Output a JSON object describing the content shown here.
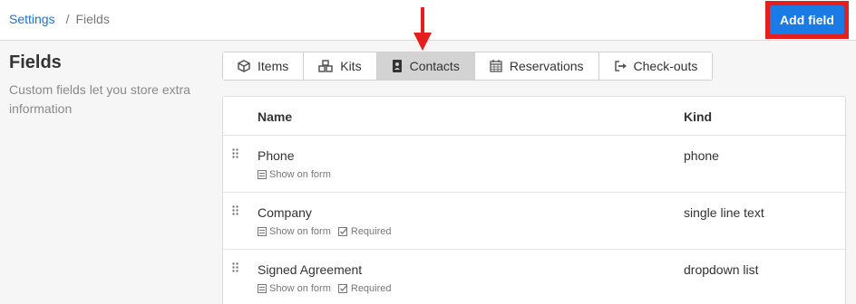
{
  "breadcrumb": {
    "parent": "Settings",
    "separator": "/",
    "current": "Fields"
  },
  "header": {
    "add_button": "Add field"
  },
  "sidebar": {
    "title": "Fields",
    "description": "Custom fields let you store extra information"
  },
  "tabs": [
    {
      "label": "Items",
      "icon": "cube-icon"
    },
    {
      "label": "Kits",
      "icon": "cubes-icon"
    },
    {
      "label": "Contacts",
      "icon": "contact-book-icon",
      "active": true
    },
    {
      "label": "Reservations",
      "icon": "calendar-icon"
    },
    {
      "label": "Check-outs",
      "icon": "sign-out-icon"
    }
  ],
  "table": {
    "columns": {
      "name": "Name",
      "kind": "Kind"
    },
    "rows": [
      {
        "name": "Phone",
        "kind": "phone",
        "badges": [
          "Show on form"
        ]
      },
      {
        "name": "Company",
        "kind": "single line text",
        "badges": [
          "Show on form",
          "Required"
        ]
      },
      {
        "name": "Signed Agreement",
        "kind": "dropdown list",
        "badges": [
          "Show on form",
          "Required"
        ]
      }
    ]
  },
  "colors": {
    "accent": "#1a7be6",
    "highlight": "#e51e1e",
    "active_tab": "#d3d3d3"
  }
}
